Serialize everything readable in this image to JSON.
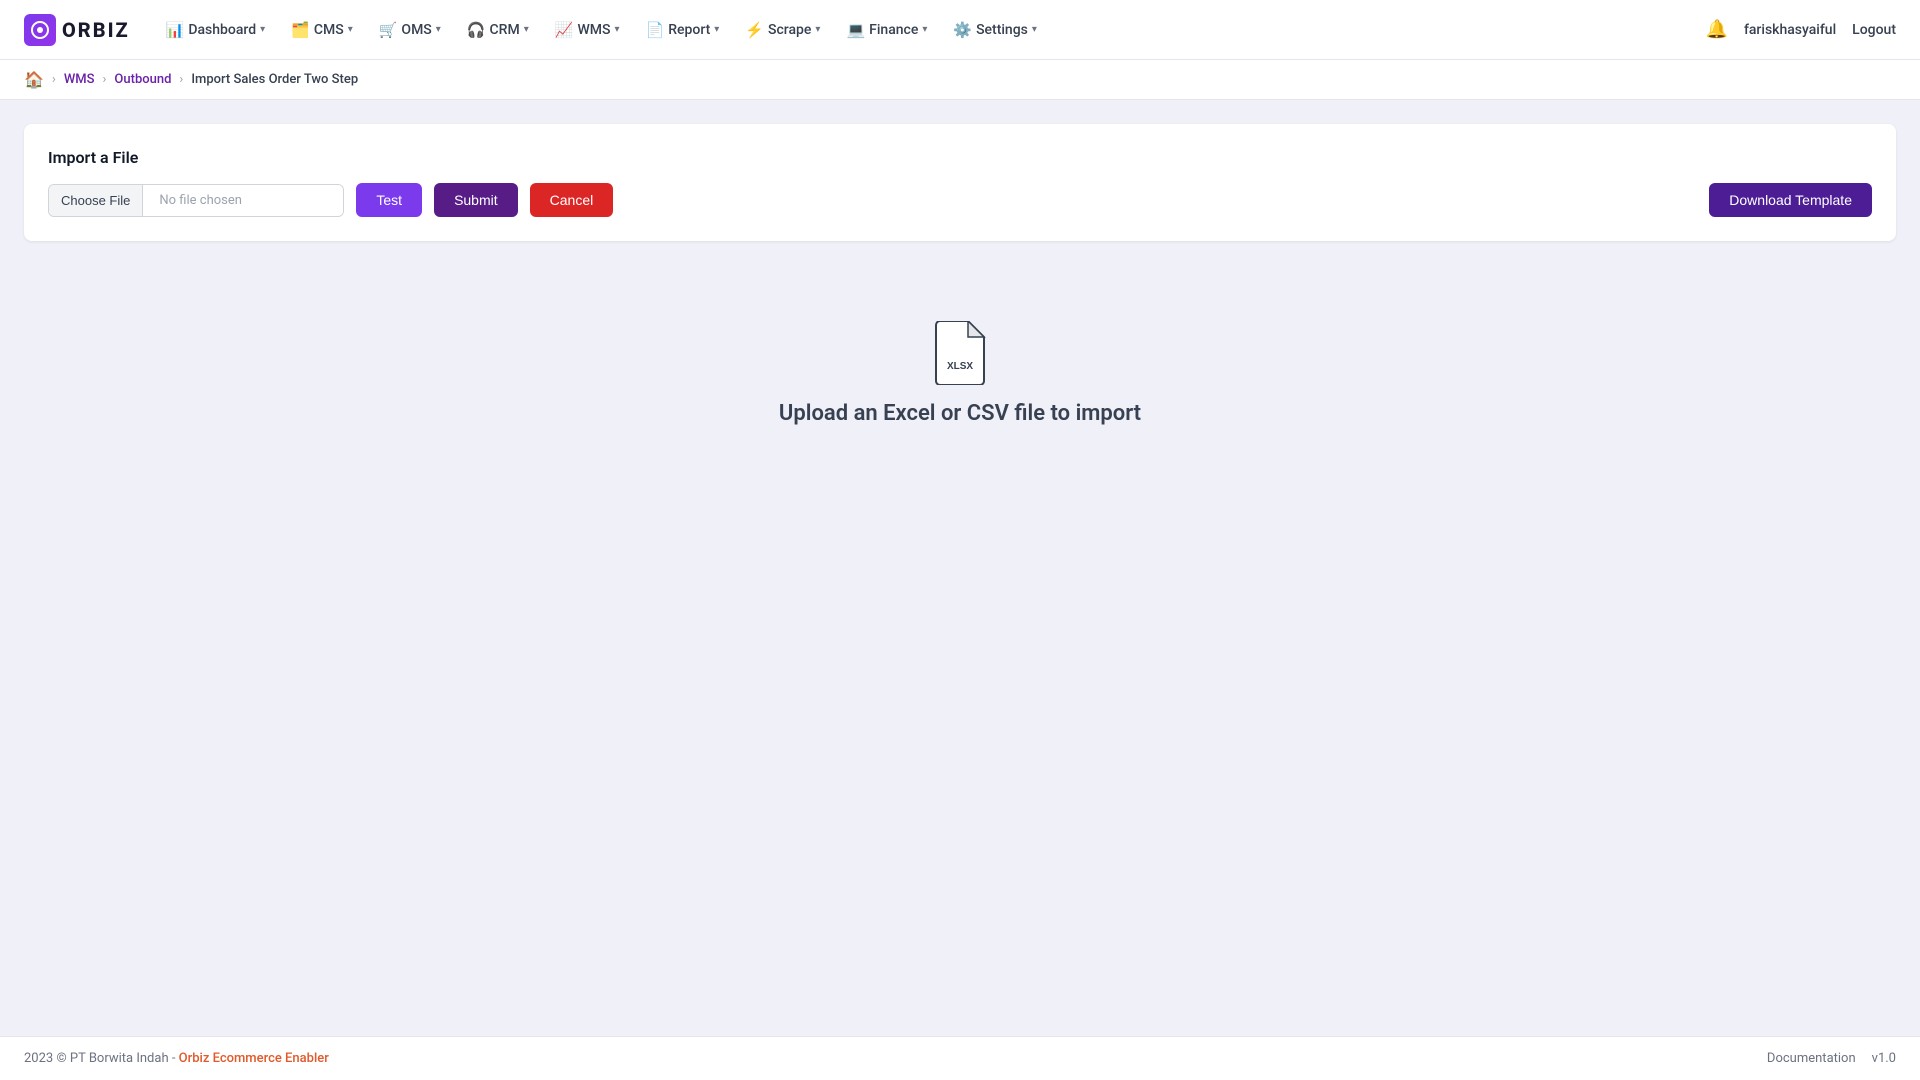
{
  "logo": {
    "icon_text": "O",
    "text": "ORBIZ"
  },
  "navbar": {
    "items": [
      {
        "id": "dashboard",
        "label": "Dashboard",
        "icon": "📊"
      },
      {
        "id": "cms",
        "label": "CMS",
        "icon": "🗂️"
      },
      {
        "id": "oms",
        "label": "OMS",
        "icon": "🛒"
      },
      {
        "id": "crm",
        "label": "CRM",
        "icon": "🎧"
      },
      {
        "id": "wms",
        "label": "WMS",
        "icon": "📈"
      },
      {
        "id": "report",
        "label": "Report",
        "icon": "📄"
      },
      {
        "id": "scrape",
        "label": "Scrape",
        "icon": "⚡"
      },
      {
        "id": "finance",
        "label": "Finance",
        "icon": "💻"
      },
      {
        "id": "settings",
        "label": "Settings",
        "icon": "⚙️"
      }
    ],
    "username": "fariskhasyaiful",
    "logout_label": "Logout"
  },
  "breadcrumb": {
    "home_icon": "🏠",
    "items": [
      {
        "label": "WMS",
        "link": true
      },
      {
        "label": "Outbound",
        "link": true
      },
      {
        "label": "Import Sales Order Two Step",
        "link": false
      }
    ]
  },
  "import_card": {
    "title": "Import a File",
    "choose_file_label": "Choose File",
    "no_file_text": "No file chosen",
    "btn_test": "Test",
    "btn_submit": "Submit",
    "btn_cancel": "Cancel",
    "btn_download": "Download Template"
  },
  "empty_state": {
    "text": "Upload an Excel or CSV file to import",
    "file_type": "XLSX"
  },
  "footer": {
    "left": "2023 © PT Borwita Indah - ",
    "brand_link_text": "Orbiz Ecommerce Enabler",
    "doc_label": "Documentation",
    "version": "v1.0"
  }
}
